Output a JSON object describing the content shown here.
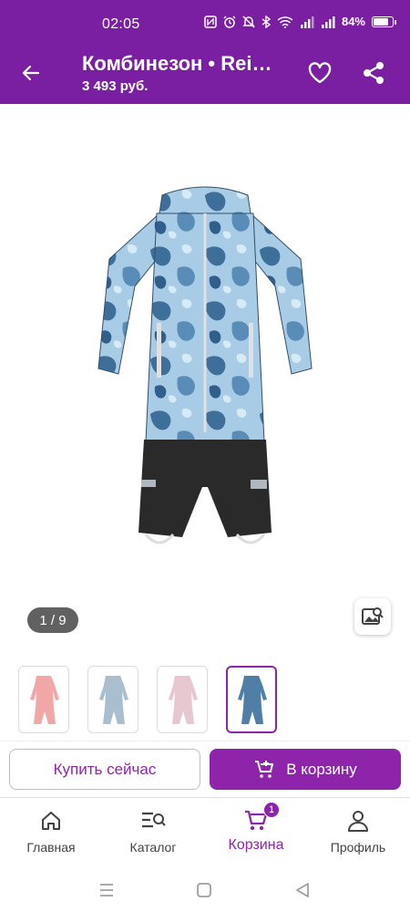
{
  "status_bar": {
    "time": "02:05",
    "battery_percent": "84%",
    "battery_level": 0.84,
    "icons": [
      "nfc-icon",
      "alarm-icon",
      "mute-icon",
      "bluetooth-icon",
      "wifi-icon",
      "signal-icon",
      "signal-icon"
    ]
  },
  "app_bar": {
    "title": "Комбинезон • Reima Kip",
    "price": "3 493 руб.",
    "icons": {
      "back": "arrow-back-icon",
      "favorite": "heart-outline-icon",
      "share": "share-icon"
    }
  },
  "gallery": {
    "page_indicator": "1 / 9",
    "current": 1,
    "total": 9,
    "image_search_icon": "image-search-icon"
  },
  "thumbnails": [
    {
      "color": "#f2a7a7",
      "active": false
    },
    {
      "color": "#a9bfd0",
      "active": false
    },
    {
      "color": "#e8c8d0",
      "active": false
    },
    {
      "color": "#4f7fa6",
      "active": true
    }
  ],
  "actions": {
    "buy_now": "Купить сейчас",
    "add_to_cart": "В корзину",
    "add_to_cart_icon": "cart-plus-icon"
  },
  "bottom_nav": {
    "items": [
      {
        "label": "Главная",
        "icon": "home-icon",
        "active": false
      },
      {
        "label": "Каталог",
        "icon": "catalog-search-icon",
        "active": false
      },
      {
        "label": "Корзина",
        "icon": "cart-icon",
        "active": true,
        "badge": "1"
      },
      {
        "label": "Профиль",
        "icon": "person-icon",
        "active": false
      }
    ]
  },
  "colors": {
    "brand": "#7b1fa2",
    "accent": "#8e24aa",
    "pill_bg": "#616161"
  }
}
